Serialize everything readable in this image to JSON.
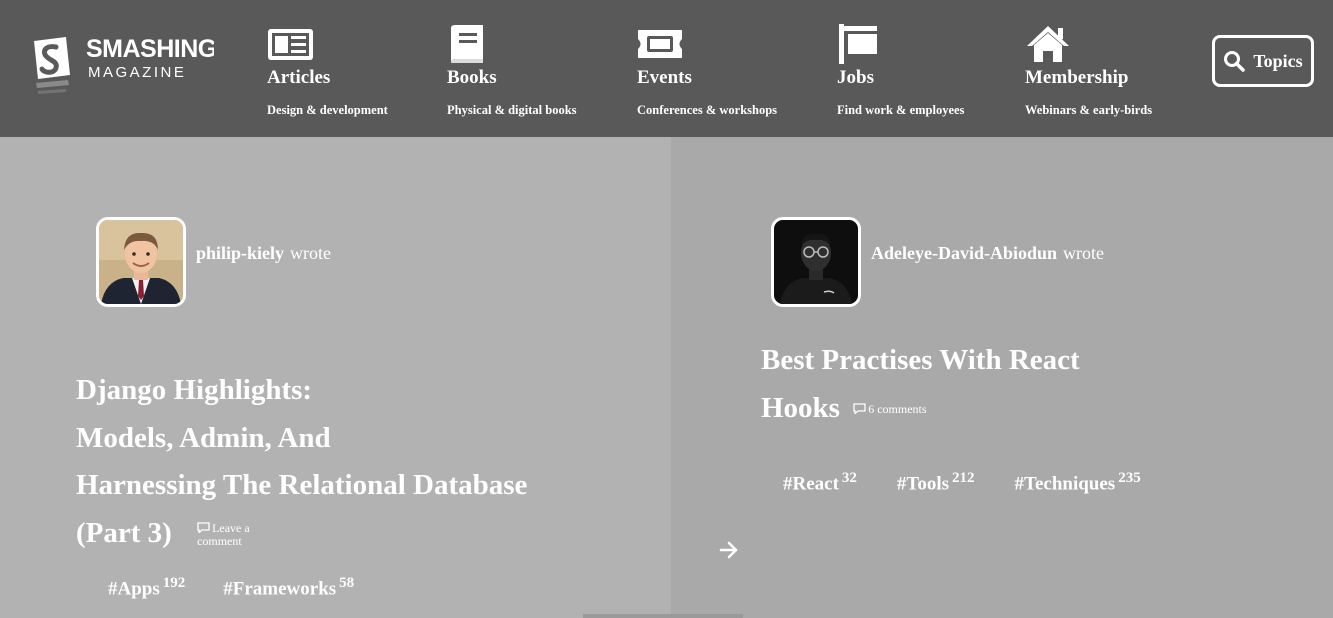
{
  "brand": {
    "line1": "SMASHING",
    "line2": "MAGAZINE"
  },
  "nav": [
    {
      "label": "Articles",
      "subtitle": "Design & development",
      "icon": "newspaper-icon"
    },
    {
      "label": "Books",
      "subtitle": "Physical & digital books",
      "icon": "book-icon"
    },
    {
      "label": "Events",
      "subtitle": "Conferences & workshops",
      "icon": "ticket-icon"
    },
    {
      "label": "Jobs",
      "subtitle": "Find work & employees",
      "icon": "signpost-icon"
    },
    {
      "label": "Membership",
      "subtitle": "Webinars & early-birds",
      "icon": "house-icon"
    }
  ],
  "topics": {
    "label": "Topics",
    "icon": "search-icon"
  },
  "articles": [
    {
      "author": "philip-kiely",
      "verb": "wrote",
      "title_lines": [
        "Django Highlights:",
        "Models, Admin, And",
        "Harnessing The Relational Database",
        "(Part 3)"
      ],
      "comments": {
        "line1": "Leave a",
        "line2": "comment"
      },
      "tags": [
        {
          "name": "#Apps",
          "count": "192"
        },
        {
          "name": "#Frameworks",
          "count": "58"
        }
      ]
    },
    {
      "author": "Adeleye-David-Abiodun",
      "verb": "wrote",
      "title_lines": [
        "Best Practises With React",
        "Hooks"
      ],
      "comments": {
        "line1": "6 comments"
      },
      "tags": [
        {
          "name": "#React",
          "count": "32"
        },
        {
          "name": "#Tools",
          "count": "212"
        },
        {
          "name": "#Techniques",
          "count": "235"
        }
      ]
    }
  ],
  "colors": {
    "header_bg": "#595959",
    "panel_left": "#b2b2b2",
    "panel_right": "#a9a9a9",
    "text": "#ffffff"
  },
  "controls": {
    "next_icon": "arrow-right-icon"
  }
}
